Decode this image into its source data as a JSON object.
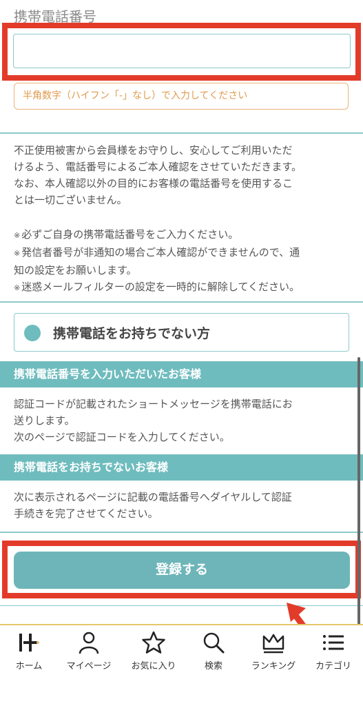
{
  "form": {
    "phone_label": "携帯電話番号",
    "phone_value": "",
    "phone_hint": "半角数字（ハイフン「-」なし）で入力してください"
  },
  "info": {
    "lines": [
      "不正使用被害から会員様をお守りし、安心してご利用いただ",
      "けるよう、電話番号によるご本人確認をさせていただきます。",
      "なお、本人確認以外の目的にお客様の電話番号を使用するこ",
      "とは一切ございません。"
    ],
    "note_mark": "※",
    "notes": [
      [
        "必ずご自身の携帯電話番号をご入力ください。"
      ],
      [
        "発信者番号が非通知の場合ご本人確認ができませんので、通",
        "知の設定をお願いします。"
      ],
      [
        "迷惑メールフィルターの設定を一時的に解除してください。"
      ]
    ]
  },
  "no_phone_option": "携帯電話をお持ちでない方",
  "sections": [
    {
      "title": "携帯電話番号を入力いただいたお客様",
      "lines": [
        "認証コードが記載されたショートメッセージを携帯電話にお",
        "送りします。",
        "次のページで認証コードを入力してください。"
      ]
    },
    {
      "title": "携帯電話をお持ちでないお客様",
      "lines": [
        "次に表示されるページに記載の電話番号へダイヤルして認証",
        "手続きを完了させてください。"
      ]
    }
  ],
  "submit_label": "登録する",
  "nav": [
    {
      "label": "ホーム",
      "icon": "home-logo-icon"
    },
    {
      "label": "マイページ",
      "icon": "person-icon"
    },
    {
      "label": "お気に入り",
      "icon": "star-icon"
    },
    {
      "label": "検索",
      "icon": "search-icon"
    },
    {
      "label": "ランキング",
      "icon": "crown-icon"
    },
    {
      "label": "カテゴリ",
      "icon": "list-icon"
    }
  ],
  "colors": {
    "highlight": "#e33b2a",
    "accent": "#6fbcbe",
    "hint": "#e09a4c",
    "nav_border": "#e5c76b"
  }
}
